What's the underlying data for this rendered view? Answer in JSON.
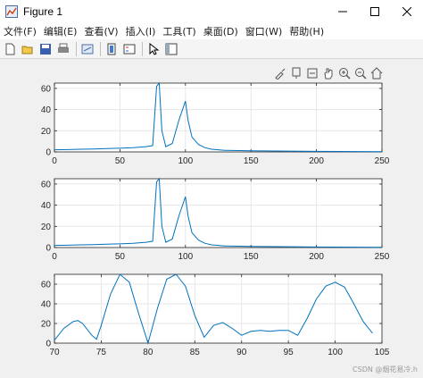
{
  "window": {
    "title": "Figure 1"
  },
  "menu": [
    "文件(F)",
    "编辑(E)",
    "查看(V)",
    "插入(I)",
    "工具(T)",
    "桌面(D)",
    "窗口(W)",
    "帮助(H)"
  ],
  "toolbar_icons": [
    "new-figure-icon",
    "open-file-icon",
    "save-icon",
    "print-icon",
    "link-plot-icon",
    "insert-colorbar-icon",
    "insert-legend-icon",
    "edit-plot-icon",
    "property-inspector-icon"
  ],
  "axes_toolbar_icons": [
    "brush-icon",
    "data-tips-icon",
    "export-icon",
    "pan-icon",
    "zoom-in-icon",
    "zoom-out-icon",
    "home-icon"
  ],
  "colors": {
    "line": "#0072BD",
    "grid": "#e6e6e6",
    "axes_bg": "#ffffff",
    "figure_bg": "#f0f0f0"
  },
  "watermark": "CSDN @烟花易冷.h",
  "chart_data": [
    {
      "type": "line",
      "xlim": [
        0,
        250
      ],
      "ylim": [
        0,
        65
      ],
      "xticks": [
        0,
        50,
        100,
        150,
        200,
        250
      ],
      "yticks": [
        0,
        20,
        40,
        60
      ],
      "grid": true,
      "x": [
        0,
        10,
        20,
        30,
        40,
        50,
        60,
        70,
        75,
        78,
        80,
        82,
        85,
        90,
        95,
        100,
        102,
        105,
        110,
        115,
        120,
        130,
        150,
        200,
        250
      ],
      "y": [
        2,
        2.2,
        2.5,
        2.8,
        3.2,
        3.5,
        4,
        5,
        6,
        62,
        65,
        20,
        5,
        8,
        30,
        48,
        30,
        14,
        7,
        4,
        2.5,
        1.5,
        1,
        0.5,
        0.2
      ]
    },
    {
      "type": "line",
      "xlim": [
        0,
        250
      ],
      "ylim": [
        0,
        65
      ],
      "xticks": [
        0,
        50,
        100,
        150,
        200,
        250
      ],
      "yticks": [
        0,
        20,
        40,
        60
      ],
      "grid": true,
      "x": [
        0,
        10,
        20,
        30,
        40,
        50,
        60,
        70,
        75,
        78,
        80,
        82,
        85,
        90,
        95,
        100,
        102,
        105,
        110,
        115,
        120,
        130,
        150,
        200,
        250
      ],
      "y": [
        2,
        2.2,
        2.5,
        2.8,
        3.2,
        3.5,
        4,
        5,
        6,
        62,
        65,
        20,
        5,
        8,
        30,
        48,
        30,
        14,
        7,
        4,
        2.5,
        1.5,
        1,
        0.5,
        0.2
      ]
    },
    {
      "type": "line",
      "xlim": [
        70,
        105
      ],
      "ylim": [
        0,
        70
      ],
      "xticks": [
        70,
        75,
        80,
        85,
        90,
        95,
        100,
        105
      ],
      "yticks": [
        0,
        20,
        40,
        60
      ],
      "grid": true,
      "x": [
        70,
        71,
        72,
        72.5,
        73,
        74,
        74.5,
        75,
        76,
        77,
        78,
        79,
        80,
        81,
        82,
        83,
        84,
        85,
        86,
        87,
        88,
        89,
        90,
        91,
        92,
        93,
        94,
        95,
        96,
        97,
        98,
        99,
        100,
        101,
        102,
        103,
        104
      ],
      "y": [
        3,
        15,
        22,
        23,
        20,
        8,
        4,
        18,
        50,
        70,
        62,
        30,
        0,
        35,
        65,
        70,
        58,
        28,
        6,
        18,
        21,
        15,
        8,
        12,
        13,
        12,
        13,
        13,
        8,
        25,
        45,
        58,
        62,
        57,
        40,
        22,
        10
      ]
    }
  ]
}
